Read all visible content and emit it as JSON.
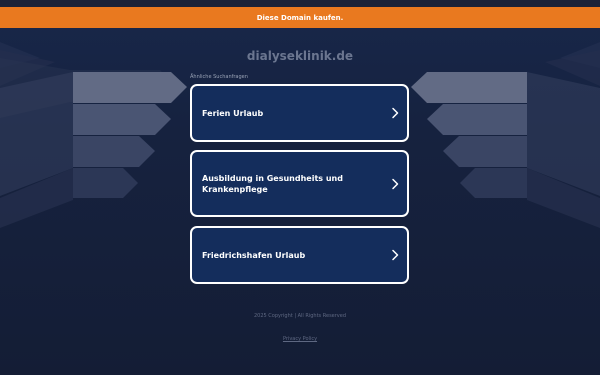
{
  "banner": {
    "text": "Diese Domain kaufen."
  },
  "site": {
    "domain": "dialyseklinik.de"
  },
  "related": {
    "heading": "Ähnliche Suchanfragen",
    "items": [
      {
        "label": "Ferien Urlaub",
        "icon": "chevron-right-icon"
      },
      {
        "label": "Ausbildung in Gesundheits und Krankenpflege",
        "icon": "chevron-right-icon"
      },
      {
        "label": "Friedrichshafen Urlaub",
        "icon": "chevron-right-icon"
      }
    ]
  },
  "footer": {
    "copyright": "2025 Copyright | All Rights Reserved",
    "privacy": "Privacy Policy"
  },
  "colors": {
    "banner": "#e9791f",
    "background": "#152039",
    "card": "#142d5c",
    "card_border": "#ffffff"
  }
}
